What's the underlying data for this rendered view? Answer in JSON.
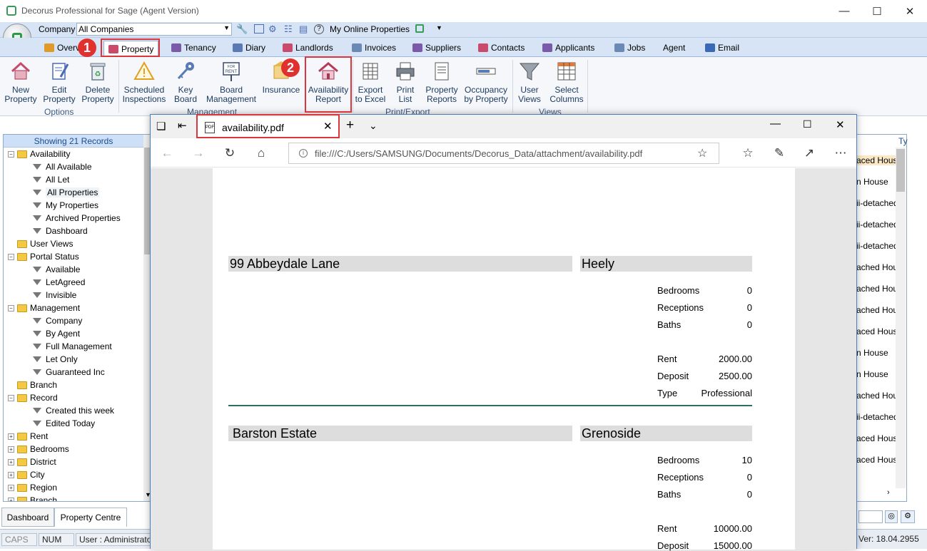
{
  "app": {
    "title": "Decorus Professional  for Sage (Agent Version)",
    "company_label": "Company",
    "company_value": "All Companies",
    "online_properties": "My Online Properties"
  },
  "tabs": [
    {
      "label": "Overv",
      "icon_color": "#e09a2a"
    },
    {
      "label": "Property",
      "icon_color": "#c94a6a"
    },
    {
      "label": "Tenancy",
      "icon_color": "#7a5aa8"
    },
    {
      "label": "Diary",
      "icon_color": "#5a7ab5"
    },
    {
      "label": "Landlords",
      "icon_color": "#c94a6a"
    },
    {
      "label": "Invoices",
      "icon_color": "#6a8ab5"
    },
    {
      "label": "Suppliers",
      "icon_color": "#7a5aa8"
    },
    {
      "label": "Contacts",
      "icon_color": "#c94a6a"
    },
    {
      "label": "Applicants",
      "icon_color": "#7a5aa8"
    },
    {
      "label": "Jobs",
      "icon_color": "#6a8ab5"
    },
    {
      "label": "Agent",
      "icon_color": ""
    },
    {
      "label": "Email",
      "icon_color": "#3a6ab5"
    }
  ],
  "ribbon": {
    "buttons": [
      {
        "line1": "New",
        "line2": "Property",
        "icon": "house-plus-icon"
      },
      {
        "line1": "Edit",
        "line2": "Property",
        "icon": "edit-document-icon"
      },
      {
        "line1": "Delete",
        "line2": "Property",
        "icon": "recycle-bin-icon"
      },
      {
        "line1": "Scheduled",
        "line2": "Inspections",
        "icon": "warning-icon"
      },
      {
        "line1": "Key",
        "line2": "Board",
        "icon": "key-icon"
      },
      {
        "line1": "Board",
        "line2": "Management",
        "icon": "for-rent-sign-icon"
      },
      {
        "line1": "Insurance",
        "line2": "",
        "icon": "insurance-icon"
      },
      {
        "line1": "Availability",
        "line2": "Report",
        "icon": "house-report-icon"
      },
      {
        "line1": "Export",
        "line2": "to Excel",
        "icon": "excel-icon"
      },
      {
        "line1": "Print",
        "line2": "List",
        "icon": "printer-icon"
      },
      {
        "line1": "Property",
        "line2": "Reports",
        "icon": "report-icon"
      },
      {
        "line1": "Occupancy",
        "line2": "by Property",
        "icon": "occupancy-icon"
      },
      {
        "line1": "User",
        "line2": "Views",
        "icon": "funnel-icon"
      },
      {
        "line1": "Select",
        "line2": "Columns",
        "icon": "columns-icon"
      }
    ],
    "groups": [
      "Options",
      "Management",
      "Print/Export",
      "Views"
    ]
  },
  "left_panel": {
    "header": "Showing 21 Records",
    "tree": [
      {
        "label": "Availability",
        "level": 0,
        "kind": "folder",
        "exp": "-"
      },
      {
        "label": "All Available",
        "level": 1,
        "kind": "filter"
      },
      {
        "label": "All Let",
        "level": 1,
        "kind": "filter"
      },
      {
        "label": "All Properties",
        "level": 1,
        "kind": "filter"
      },
      {
        "label": "My Properties",
        "level": 1,
        "kind": "filter"
      },
      {
        "label": "Archived Properties",
        "level": 1,
        "kind": "filter"
      },
      {
        "label": "Dashboard",
        "level": 1,
        "kind": "filter"
      },
      {
        "label": "User Views",
        "level": 0,
        "kind": "folder",
        "exp": ""
      },
      {
        "label": "Portal Status",
        "level": 0,
        "kind": "folder",
        "exp": "-"
      },
      {
        "label": "Available",
        "level": 1,
        "kind": "filter"
      },
      {
        "label": "LetAgreed",
        "level": 1,
        "kind": "filter"
      },
      {
        "label": "Invisible",
        "level": 1,
        "kind": "filter"
      },
      {
        "label": "Management",
        "level": 0,
        "kind": "folder",
        "exp": "-"
      },
      {
        "label": "Company",
        "level": 1,
        "kind": "filter"
      },
      {
        "label": "By Agent",
        "level": 1,
        "kind": "filter"
      },
      {
        "label": "Full Management",
        "level": 1,
        "kind": "filter"
      },
      {
        "label": "Let Only",
        "level": 1,
        "kind": "filter"
      },
      {
        "label": "Guaranteed Inc",
        "level": 1,
        "kind": "filter"
      },
      {
        "label": "Branch",
        "level": 0,
        "kind": "folder",
        "exp": ""
      },
      {
        "label": "Record",
        "level": 0,
        "kind": "folder",
        "exp": "-"
      },
      {
        "label": "Created this week",
        "level": 1,
        "kind": "filter"
      },
      {
        "label": "Edited Today",
        "level": 1,
        "kind": "filter"
      },
      {
        "label": "Rent",
        "level": 0,
        "kind": "folder",
        "exp": "+"
      },
      {
        "label": "Bedrooms",
        "level": 0,
        "kind": "folder",
        "exp": "+"
      },
      {
        "label": "District",
        "level": 0,
        "kind": "folder",
        "exp": "+"
      },
      {
        "label": "City",
        "level": 0,
        "kind": "folder",
        "exp": "+"
      },
      {
        "label": "Region",
        "level": 0,
        "kind": "folder",
        "exp": "+"
      },
      {
        "label": "Branch",
        "level": 0,
        "kind": "folder",
        "exp": "+"
      }
    ]
  },
  "bottom_tabs": [
    "Dashboard",
    "Property Centre"
  ],
  "status": {
    "caps": "CAPS",
    "num": "NUM",
    "user": "User : Administrato",
    "version": "Ver: 18.04.2955"
  },
  "right_grid": {
    "header": "Ty",
    "cells": [
      "aced Hous",
      "n House",
      "ii-detached",
      "ii-detached",
      "ii-detached",
      "ached Hous",
      "ached Hous",
      "ached Hous",
      "aced Hous",
      "n House",
      "n House",
      "ached Hous",
      "ii-detached",
      "aced Hous",
      "aced Hous"
    ]
  },
  "browser": {
    "tab_title": "availability.pdf",
    "url": "file:///C:/Users/SAMSUNG/Documents/Decorus_Data/attachment/availability.pdf"
  },
  "pdf": {
    "properties": [
      {
        "name": "99 Abbeydale Lane",
        "district": "Heely",
        "bedrooms_label": "Bedrooms",
        "bedrooms": "0",
        "receptions_label": "Receptions",
        "receptions": "0",
        "baths_label": "Baths",
        "baths": "0",
        "rent_label": "Rent",
        "rent": "2000.00",
        "deposit_label": "Deposit",
        "deposit": "2500.00",
        "type_label": "Type",
        "type": "Professional"
      },
      {
        "name": "Barston Estate",
        "district": "Grenoside",
        "bedrooms_label": "Bedrooms",
        "bedrooms": "10",
        "receptions_label": "Receptions",
        "receptions": "0",
        "baths_label": "Baths",
        "baths": "0",
        "rent_label": "Rent",
        "rent": "10000.00",
        "deposit_label": "Deposit",
        "deposit": "15000.00"
      }
    ]
  },
  "callouts": [
    "1",
    "2"
  ],
  "colors": {
    "accent_red": "#d9363e",
    "pdf_divider": "#2e6e63",
    "ribbon_bg": "#d6e4f5"
  }
}
